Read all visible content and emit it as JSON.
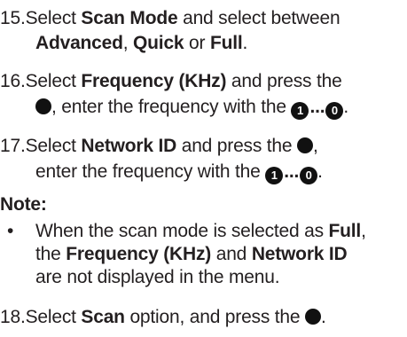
{
  "step15": {
    "number": "15.",
    "a": "Select ",
    "b1": "Scan Mode",
    "c": " and select between",
    "line2_b1": "Advanced",
    "line2_a": ", ",
    "line2_b2": "Quick",
    "line2_c": " or ",
    "line2_b3": "Full",
    "line2_d": "."
  },
  "step16": {
    "number": "16.",
    "a": "Select ",
    "b1": "Frequency (KHz)",
    "c": " and press the",
    "line2_a": ", enter the frequency with the ",
    "key_start": "1",
    "ellipsis": "...",
    "key_end": "0",
    "line2_end": "."
  },
  "step17": {
    "number": "17.",
    "a": "Select ",
    "b1": "Network ID",
    "c": " and press the ",
    "c_end": ",",
    "line2_a": "enter the frequency with the ",
    "key_start": "1",
    "ellipsis": "...",
    "key_end": "0",
    "line2_end": "."
  },
  "note": {
    "heading": "Note:",
    "bullet": "•",
    "l1_a": "When the scan mode is selected as ",
    "l1_b": "Full",
    "l1_c": ",",
    "l2_a": "the ",
    "l2_b1": "Frequency (KHz)",
    "l2_c": " and ",
    "l2_b2": "Network ID",
    "l3": "are not displayed in the menu."
  },
  "step18": {
    "number": "18.",
    "a": "Select ",
    "b1": "Scan",
    "c": " option, and press the ",
    "end": "."
  },
  "icons": {
    "ok_button": "filled-circle-icon",
    "numeric_key": "circled-number-icon"
  }
}
